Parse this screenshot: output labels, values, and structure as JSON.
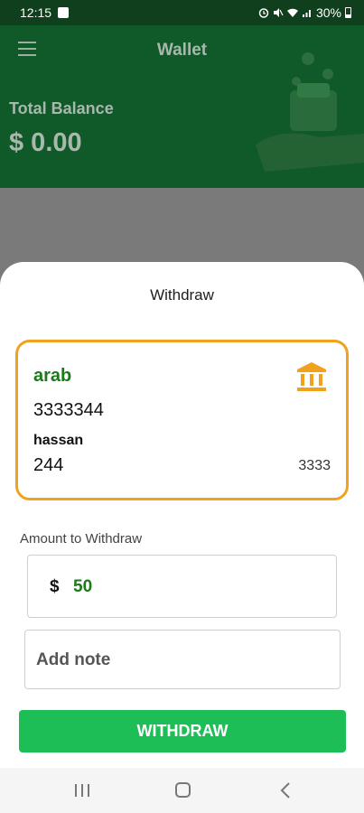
{
  "status_bar": {
    "time": "12:15",
    "battery": "30%"
  },
  "header": {
    "title": "Wallet",
    "balance_label": "Total Balance",
    "balance_value": "$ 0.00"
  },
  "sheet": {
    "title": "Withdraw",
    "bank_card": {
      "bank_name": "arab",
      "account_number": "3333344",
      "holder_name": "hassan",
      "branch": "244",
      "code": "3333"
    },
    "amount": {
      "label": "Amount to Withdraw",
      "currency": "$",
      "value": "50"
    },
    "note": {
      "placeholder": "Add note"
    },
    "withdraw_button": "WITHDRAW"
  },
  "colors": {
    "accent_green": "#1dbe55",
    "card_border": "#f0a21c",
    "header_bg": "#0f5a28"
  }
}
